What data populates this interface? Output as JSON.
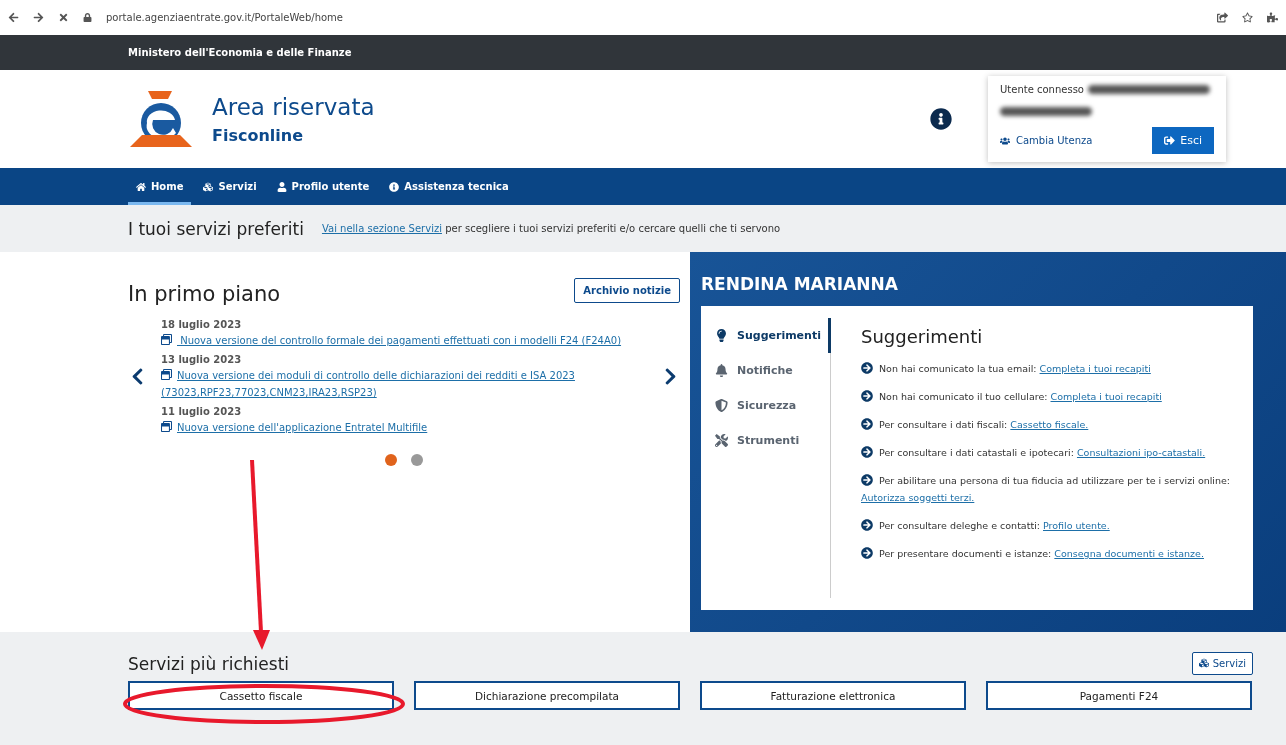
{
  "browser": {
    "url": "portale.agenziaentrate.gov.it/PortaleWeb/home"
  },
  "ministry": "Ministero dell'Economia e delle Finanze",
  "header": {
    "title": "Area riservata",
    "subtitle": "Fisconline",
    "user_label": "Utente connesso",
    "switch_user": "Cambia Utenza",
    "logout": "Esci"
  },
  "nav": [
    {
      "label": "Home",
      "selected": true
    },
    {
      "label": "Servizi",
      "selected": false
    },
    {
      "label": "Profilo utente",
      "selected": false
    },
    {
      "label": "Assistenza tecnica",
      "selected": false
    }
  ],
  "favorites": {
    "title": "I tuoi servizi preferiti",
    "link": "Vai nella sezione Servizi",
    "text": "per scegliere i tuoi servizi preferiti e/o cercare quelli che ti servono"
  },
  "news": {
    "title": "In primo piano",
    "archive_button": "Archivio notizie",
    "items": [
      {
        "date": "18 luglio 2023",
        "link": " Nuova versione del controllo formale dei pagamenti effettuati con i modelli F24 (F24A0)"
      },
      {
        "date": "13 luglio 2023",
        "link": "Nuova versione dei moduli di controllo delle dichiarazioni dei redditi e ISA 2023 (73023,RPF23,77023,CNM23,IRA23,RSP23)"
      },
      {
        "date": "11 luglio 2023",
        "link": "Nuova versione dell'applicazione Entratel Multifile"
      }
    ],
    "dots": [
      {
        "selected": true
      },
      {
        "selected": false
      }
    ]
  },
  "user_panel": {
    "name": "RENDINA MARIANNA",
    "menu": [
      {
        "label": "Suggerimenti",
        "selected": true
      },
      {
        "label": "Notifiche",
        "selected": false
      },
      {
        "label": "Sicurezza",
        "selected": false
      },
      {
        "label": "Strumenti",
        "selected": false
      }
    ],
    "heading": "Suggerimenti",
    "tips": [
      {
        "text": "Non hai comunicato la tua email:",
        "link": "Completa i tuoi recapiti"
      },
      {
        "text": "Non hai comunicato il tuo cellulare:",
        "link": "Completa i tuoi recapiti"
      },
      {
        "text": "Per consultare i dati fiscali:",
        "link": "Cassetto fiscale."
      },
      {
        "text": "Per consultare i dati catastali e ipotecari:",
        "link": "Consultazioni ipo-catastali."
      },
      {
        "text": "Per abilitare una persona di tua fiducia ad utilizzare per te i servizi online:",
        "link": "Autorizza soggetti terzi."
      },
      {
        "text": "Per consultare deleghe e contatti:",
        "link": "Profilo utente."
      },
      {
        "text": "Per presentare documenti e istanze:",
        "link": "Consegna documenti e istanze."
      }
    ]
  },
  "services": {
    "title": "Servizi più richiesti",
    "button": "Servizi",
    "items": [
      "Cassetto fiscale",
      "Dichiarazione precompilata",
      "Fatturazione elettronica",
      "Pagamenti F24"
    ]
  }
}
